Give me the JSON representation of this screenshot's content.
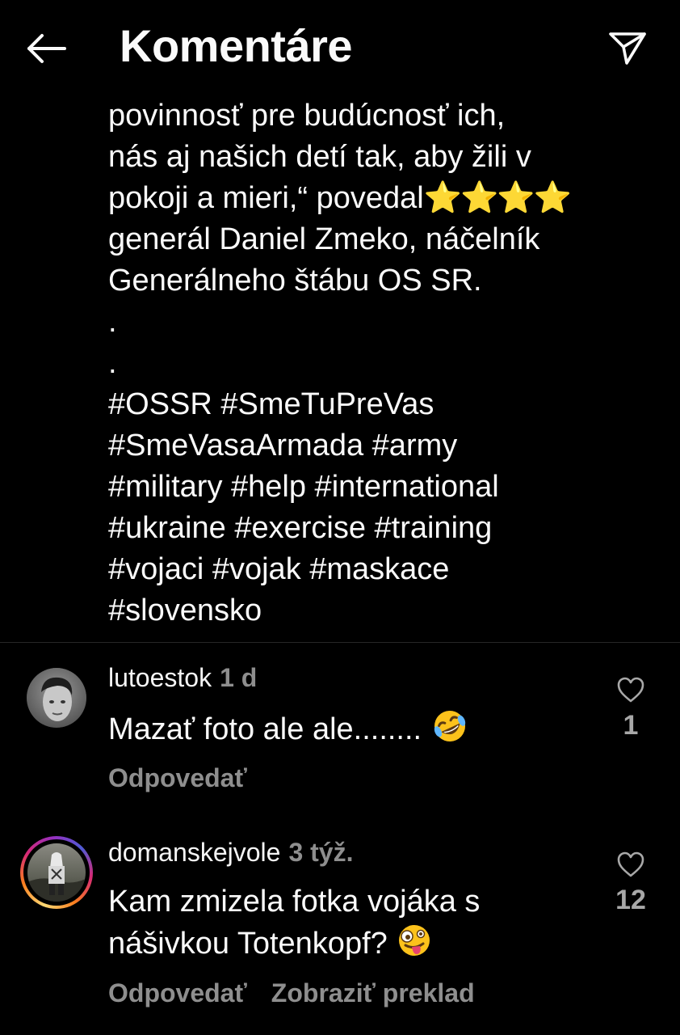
{
  "header": {
    "title": "Komentáre",
    "back_icon": "arrow-left-icon",
    "send_icon": "paper-plane-icon"
  },
  "caption": {
    "lines": [
      "povinnosť pre budúcnosť ich,",
      "nás aj našich detí tak, aby žili v",
      "pokoji a mieri,“ povedal",
      "generál Daniel Zmeko, náčelník",
      "Generálneho štábu OS SR."
    ],
    "stars": "⭐⭐⭐⭐",
    "dots": [
      ".",
      "."
    ],
    "hashtag_lines": [
      "#OSSR #SmeTuPreVas",
      "#SmeVasaArmada #army",
      "#military #help #international",
      "#ukraine #exercise #training",
      "#vojaci #vojak #maskace",
      "#slovensko"
    ]
  },
  "comments": [
    {
      "username": "lutoestok",
      "time": "1 d",
      "lines": [
        "Mazať foto ale ale........"
      ],
      "emoji": "rolling-on-floor-laughing",
      "reply_label": "Odpovedať",
      "likes": "1",
      "has_story_ring": false
    },
    {
      "username": "domanskejvole",
      "time": "3 týž.",
      "lines": [
        "Kam zmizela fotka vojáka s",
        "nášivkou Totenkopf?"
      ],
      "emoji": "zany-face",
      "reply_label": "Odpovedať",
      "translate_label": "Zobraziť preklad",
      "likes": "12",
      "has_story_ring": true
    }
  ],
  "colors": {
    "background": "#000000",
    "text": "#fafafa",
    "secondary": "#8e8e8e",
    "divider": "#262626",
    "story_ring_start": "#feda75",
    "story_ring_mid": "#d62976",
    "story_ring_end": "#962fbf"
  }
}
